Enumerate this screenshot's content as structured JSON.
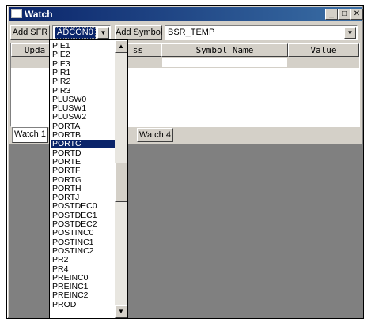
{
  "window": {
    "title": "Watch",
    "controls": {
      "minimize": "_",
      "maximize": "□",
      "close": "✕"
    }
  },
  "toolbar": {
    "add_sfr_label": "Add SFR",
    "sfr_selected": "ADCON0",
    "add_symbol_label": "Add Symbol",
    "symbol_value": "BSR_TEMP"
  },
  "table": {
    "headers": [
      "Upda",
      "ss",
      "Symbol Name",
      "Value"
    ]
  },
  "tabs": [
    "Watch 1",
    "Watch 4"
  ],
  "dropdown": {
    "items": [
      "PIE1",
      "PIE2",
      "PIE3",
      "PIR1",
      "PIR2",
      "PIR3",
      "PLUSW0",
      "PLUSW1",
      "PLUSW2",
      "PORTA",
      "PORTB",
      "PORTC",
      "PORTD",
      "PORTE",
      "PORTF",
      "PORTG",
      "PORTH",
      "PORTJ",
      "POSTDEC0",
      "POSTDEC1",
      "POSTDEC2",
      "POSTINC0",
      "POSTINC1",
      "POSTINC2",
      "PR2",
      "PR4",
      "PREINC0",
      "PREINC1",
      "PREINC2",
      "PROD"
    ],
    "highlighted": "PORTC"
  },
  "icons": {
    "combo_arrow": "▼",
    "scroll_up": "▲",
    "scroll_down": "▼"
  }
}
